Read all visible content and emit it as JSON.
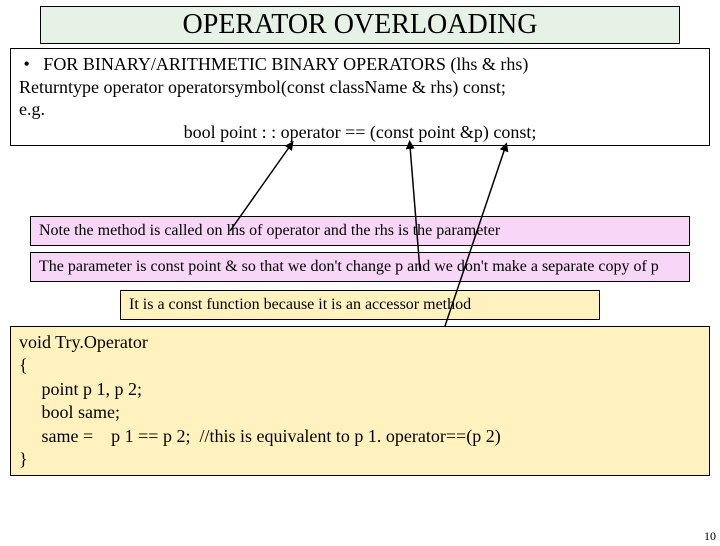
{
  "title": "OPERATOR OVERLOADING",
  "intro": {
    "line1": " •   FOR BINARY/ARITHMETIC BINARY OPERATORS (lhs & rhs)",
    "line2": "Returntype operator operatorsymbol(const className & rhs) const;",
    "line3": "e.g.",
    "line4": "bool point : : operator == (const point &p) const;"
  },
  "notes": {
    "pink1": "Note the method is called on lhs of operator and the rhs is the parameter",
    "pink2": "The parameter is const point & so that we don't change p and we don't make a separate copy of p",
    "yellow": "It is a const function because it is an accessor method"
  },
  "code": "void Try.Operator\n{\n     point p 1, p 2;\n     bool same;\n     same =    p 1 == p 2;  //this is equivalent to p 1. operator==(p 2)\n}",
  "slide_number": "10"
}
